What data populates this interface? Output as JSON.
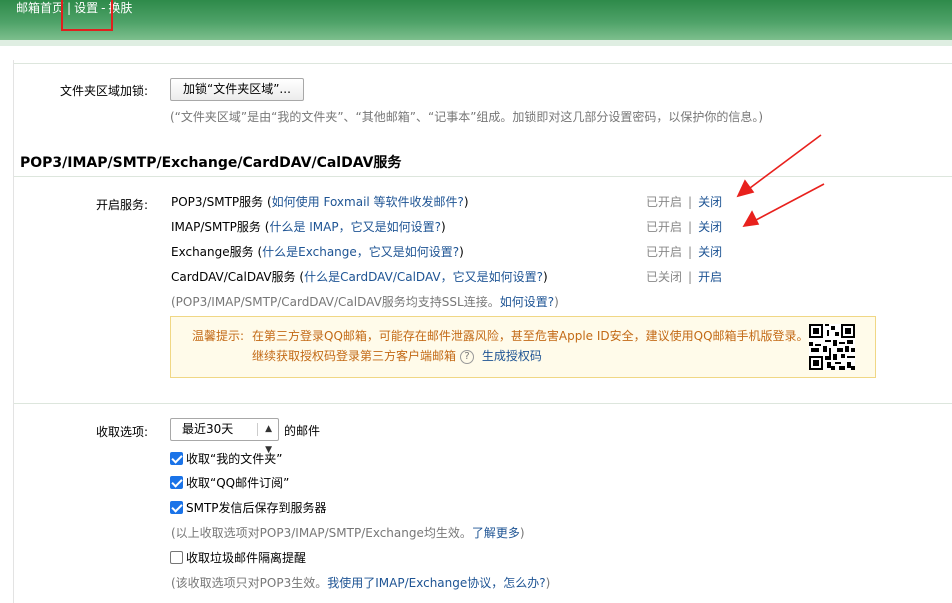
{
  "header": {
    "nav": [
      "邮箱首页",
      "设置",
      "换肤"
    ],
    "separators": [
      "|",
      "-"
    ]
  },
  "folder_lock": {
    "label": "文件夹区域加锁:",
    "button": "加锁“文件夹区域”...",
    "hint": "(“文件夹区域”是由“我的文件夹”、“其他邮箱”、“记事本”组成。加锁即对这几部分设置密码，以保护你的信息。)"
  },
  "protocols": {
    "title": "POP3/IMAP/SMTP/Exchange/CardDAV/CalDAV服务",
    "label": "开启服务:",
    "bar": "|",
    "services": [
      {
        "name": "POP3/SMTP服务",
        "open": "(",
        "help": "如何使用 Foxmail 等软件收发邮件?",
        "close": ")",
        "status": "已开启",
        "action": "关闭"
      },
      {
        "name": "IMAP/SMTP服务",
        "open": "(",
        "help": "什么是 IMAP，它又是如何设置?",
        "close": ")",
        "status": "已开启",
        "action": "关闭"
      },
      {
        "name": "Exchange服务",
        "open": "(",
        "help": "什么是Exchange，它又是如何设置?",
        "close": ")",
        "status": "已开启",
        "action": "关闭"
      },
      {
        "name": "CardDAV/CalDAV服务",
        "open": "(",
        "help": "什么是CardDAV/CalDAV，它又是如何设置?",
        "close": ")",
        "status": "已关闭",
        "action": "开启"
      }
    ],
    "ssl_note_prefix": "(POP3/IMAP/SMTP/CardDAV/CalDAV服务均支持SSL连接。",
    "ssl_note_link": "如何设置?",
    "ssl_note_suffix": ")",
    "tip": {
      "label": "温馨提示:",
      "line1": "在第三方登录QQ邮箱，可能存在邮件泄露风险，甚至危害Apple ID安全，建议使用QQ邮箱手机版登录。",
      "line2": "继续获取授权码登录第三方客户端邮箱",
      "qmark": "?",
      "link": "生成授权码"
    }
  },
  "receive": {
    "label": "收取选项:",
    "select_value": "最近30天",
    "select_suffix": "的邮件",
    "options": [
      {
        "label": "收取“我的文件夹”",
        "checked": true
      },
      {
        "label": "收取“QQ邮件订阅”",
        "checked": true
      },
      {
        "label": "SMTP发信后保存到服务器",
        "checked": true
      }
    ],
    "note1_prefix": "(以上收取选项对POP3/IMAP/SMTP/Exchange均生效。",
    "note1_link": "了解更多",
    "note1_suffix": ")",
    "spam_option": {
      "label": "收取垃圾邮件隔离提醒",
      "checked": false
    },
    "note2_prefix": "(该收取选项只对POP3生效。",
    "note2_link": "我使用了IMAP/Exchange协议，怎么办?",
    "note2_suffix": ")"
  },
  "colors": {
    "header_green": "#4ea268",
    "link_blue": "#1e5494",
    "highlight_red": "#e0201e",
    "tip_orange": "#c36a16",
    "checkbox_blue": "#1a73e8"
  }
}
